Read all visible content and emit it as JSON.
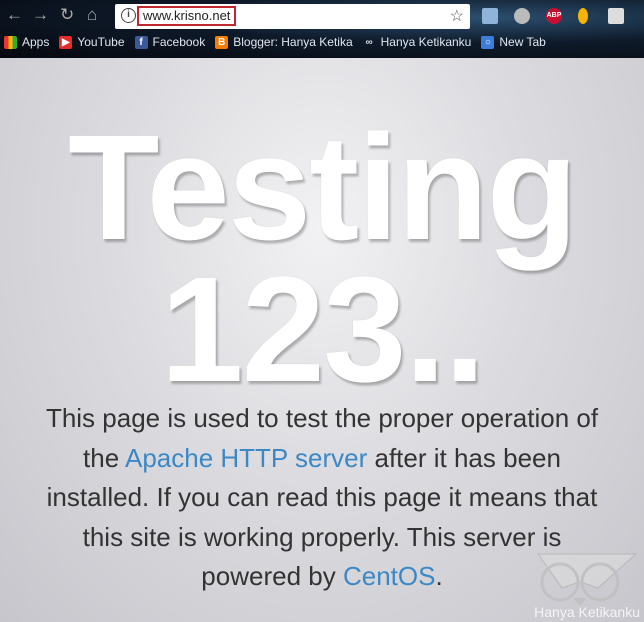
{
  "browser": {
    "url": "www.krisno.net",
    "nav": {
      "back": "back-icon",
      "forward": "forward-icon",
      "reload": "reload-icon",
      "home": "home-icon"
    },
    "extensions": [
      "folder-extension",
      "globe-extension",
      "adblock-plus",
      "lightbulb-extension",
      "notes-extension"
    ],
    "adblock_label": "ABP",
    "bookmarks": [
      {
        "label": "Apps",
        "icon": "apps-grid-icon"
      },
      {
        "label": "YouTube",
        "icon": "youtube-icon",
        "color": "#e52d27"
      },
      {
        "label": "Facebook",
        "icon": "facebook-icon",
        "color": "#3b5998"
      },
      {
        "label": "Blogger: Hanya Ketika",
        "icon": "blogger-icon",
        "color": "#f57d00"
      },
      {
        "label": "Hanya Ketikanku",
        "icon": "mask-icon"
      },
      {
        "label": "New Tab",
        "icon": "new-tab-icon",
        "color": "#3b7dd8"
      }
    ]
  },
  "page": {
    "heading1": "Testing",
    "heading2": "123..",
    "para_1": "This page is used to test the proper operation of the ",
    "link_apache": "Apache HTTP server",
    "para_2": " after it has been installed. If you can read this page it means that this site is working properly. This server is powered by ",
    "link_centos": "CentOS",
    "para_3": ".",
    "link_color": "#3c88c6"
  },
  "watermark": {
    "text": "Hanya Ketikanku",
    "icon": "owl-icon"
  }
}
